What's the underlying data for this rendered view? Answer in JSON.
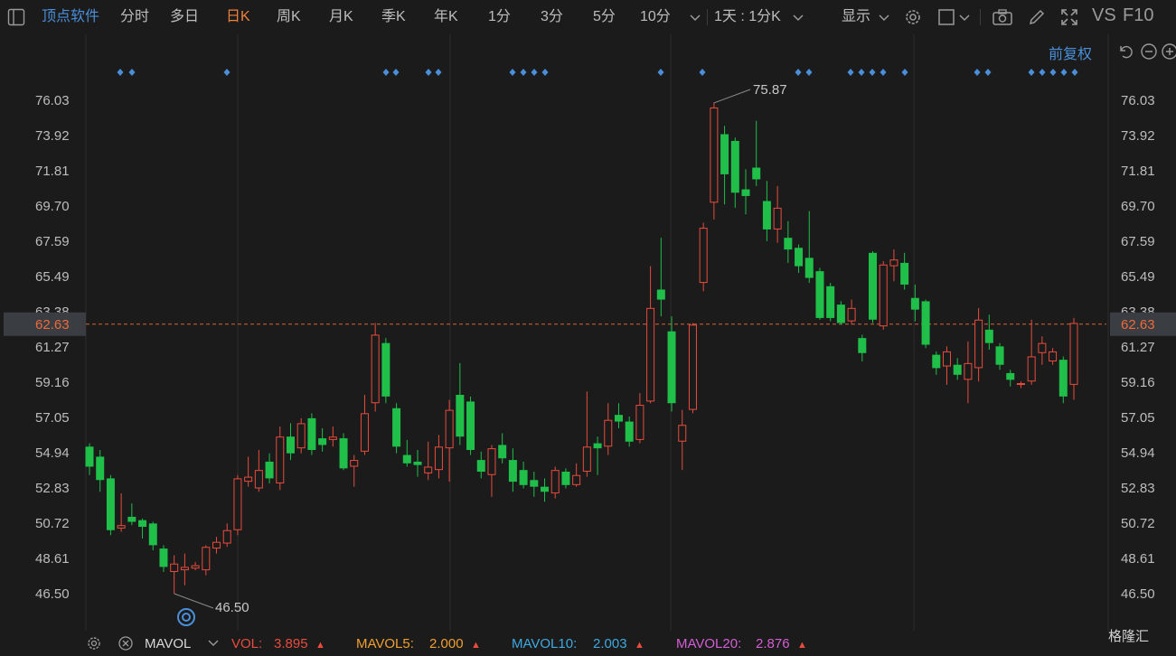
{
  "toolbar": {
    "app_name": "顶点软件",
    "periods": [
      "分时",
      "多日",
      "日K",
      "周K",
      "月K",
      "季K",
      "年K",
      "1分",
      "3分",
      "5分",
      "10分"
    ],
    "active_period": "日K",
    "interval_label": "1天 : 1分K",
    "display_label": "显示",
    "vs_label": "VS",
    "f10_label": "F10"
  },
  "chart_header": {
    "fq_label": "前复权"
  },
  "price_axis": {
    "labels": [
      "76.03",
      "73.92",
      "71.81",
      "69.70",
      "67.59",
      "65.49",
      "63.38",
      "61.27",
      "59.16",
      "57.05",
      "54.94",
      "52.83",
      "50.72",
      "48.61",
      "46.50"
    ],
    "current_price_label": "62.63"
  },
  "annotations": {
    "high_label": "75.87",
    "low_label": "46.50"
  },
  "indicator_bar": {
    "name": "MAVOL",
    "items": [
      {
        "label": "VOL:",
        "value": "3.895",
        "color": "#e84c3d"
      },
      {
        "label": "MAVOL5:",
        "value": "2.000",
        "color": "#f0a030"
      },
      {
        "label": "MAVOL10:",
        "value": "2.003",
        "color": "#3fa9e0"
      },
      {
        "label": "MAVOL20:",
        "value": "2.876",
        "color": "#d45ed4"
      }
    ]
  },
  "watermark": "格隆汇",
  "colors": {
    "up": "#e84c3d",
    "down": "#1fbf4a",
    "accent": "#4a8fd9",
    "active": "#f0813a",
    "grid": "#2c2c2e"
  },
  "chart_data": {
    "type": "candlestick",
    "ylim": [
      45.5,
      77.5
    ],
    "current_price": 62.63,
    "candles": [
      {
        "o": 55.3,
        "c": 54.1,
        "h": 55.5,
        "l": 53.6
      },
      {
        "o": 54.7,
        "c": 53.3,
        "h": 55.1,
        "l": 52.6
      },
      {
        "o": 53.4,
        "c": 50.3,
        "h": 53.6,
        "l": 50.0
      },
      {
        "o": 50.4,
        "c": 50.6,
        "h": 52.5,
        "l": 50.2
      },
      {
        "o": 51.1,
        "c": 50.8,
        "h": 51.9,
        "l": 50.6
      },
      {
        "o": 50.9,
        "c": 50.5,
        "h": 51.0,
        "l": 49.8
      },
      {
        "o": 50.7,
        "c": 49.4,
        "h": 50.8,
        "l": 49.1
      },
      {
        "o": 49.2,
        "c": 48.1,
        "h": 49.4,
        "l": 47.8
      },
      {
        "o": 47.8,
        "c": 48.3,
        "h": 48.8,
        "l": 46.5
      },
      {
        "o": 47.9,
        "c": 48.1,
        "h": 48.9,
        "l": 47.0
      },
      {
        "o": 48.0,
        "c": 48.2,
        "h": 48.4,
        "l": 47.9
      },
      {
        "o": 47.9,
        "c": 49.3,
        "h": 49.4,
        "l": 47.6
      },
      {
        "o": 49.2,
        "c": 49.6,
        "h": 49.9,
        "l": 48.9
      },
      {
        "o": 49.5,
        "c": 50.3,
        "h": 50.7,
        "l": 49.3
      },
      {
        "o": 50.3,
        "c": 53.4,
        "h": 53.6,
        "l": 50.0
      },
      {
        "o": 53.2,
        "c": 53.5,
        "h": 54.7,
        "l": 52.9
      },
      {
        "o": 52.8,
        "c": 53.9,
        "h": 55.1,
        "l": 52.6
      },
      {
        "o": 54.4,
        "c": 53.4,
        "h": 54.9,
        "l": 53.1
      },
      {
        "o": 53.1,
        "c": 55.9,
        "h": 56.5,
        "l": 52.7
      },
      {
        "o": 55.9,
        "c": 54.9,
        "h": 56.7,
        "l": 54.5
      },
      {
        "o": 55.2,
        "c": 56.7,
        "h": 57.0,
        "l": 54.9
      },
      {
        "o": 57.0,
        "c": 55.1,
        "h": 57.3,
        "l": 54.8
      },
      {
        "o": 55.8,
        "c": 55.4,
        "h": 56.4,
        "l": 55.0
      },
      {
        "o": 55.7,
        "c": 55.9,
        "h": 56.5,
        "l": 55.3
      },
      {
        "o": 55.8,
        "c": 54.0,
        "h": 56.1,
        "l": 53.9
      },
      {
        "o": 54.1,
        "c": 54.5,
        "h": 54.8,
        "l": 52.9
      },
      {
        "o": 55.0,
        "c": 57.3,
        "h": 58.4,
        "l": 54.8
      },
      {
        "o": 57.9,
        "c": 62.0,
        "h": 62.7,
        "l": 57.4
      },
      {
        "o": 61.5,
        "c": 58.3,
        "h": 61.8,
        "l": 57.9
      },
      {
        "o": 57.6,
        "c": 55.3,
        "h": 57.9,
        "l": 54.9
      },
      {
        "o": 54.8,
        "c": 54.3,
        "h": 55.7,
        "l": 54.1
      },
      {
        "o": 54.4,
        "c": 54.2,
        "h": 55.1,
        "l": 53.5
      },
      {
        "o": 53.7,
        "c": 54.1,
        "h": 55.6,
        "l": 53.3
      },
      {
        "o": 53.9,
        "c": 55.3,
        "h": 56.0,
        "l": 53.4
      },
      {
        "o": 55.2,
        "c": 57.5,
        "h": 58.1,
        "l": 53.2
      },
      {
        "o": 58.4,
        "c": 55.9,
        "h": 60.3,
        "l": 55.4
      },
      {
        "o": 58.0,
        "c": 55.1,
        "h": 58.3,
        "l": 54.8
      },
      {
        "o": 54.5,
        "c": 53.8,
        "h": 55.0,
        "l": 53.4
      },
      {
        "o": 53.6,
        "c": 55.2,
        "h": 55.4,
        "l": 52.3
      },
      {
        "o": 55.4,
        "c": 54.6,
        "h": 56.1,
        "l": 54.3
      },
      {
        "o": 54.5,
        "c": 53.2,
        "h": 55.2,
        "l": 52.6
      },
      {
        "o": 53.9,
        "c": 53.0,
        "h": 54.4,
        "l": 52.8
      },
      {
        "o": 53.3,
        "c": 52.9,
        "h": 53.8,
        "l": 52.3
      },
      {
        "o": 52.9,
        "c": 52.6,
        "h": 53.4,
        "l": 52.0
      },
      {
        "o": 52.5,
        "c": 53.9,
        "h": 54.1,
        "l": 52.2
      },
      {
        "o": 53.8,
        "c": 53.0,
        "h": 54.0,
        "l": 52.8
      },
      {
        "o": 53.0,
        "c": 53.6,
        "h": 54.3,
        "l": 52.9
      },
      {
        "o": 53.8,
        "c": 55.3,
        "h": 58.6,
        "l": 53.5
      },
      {
        "o": 55.5,
        "c": 55.2,
        "h": 55.9,
        "l": 53.6
      },
      {
        "o": 55.3,
        "c": 56.9,
        "h": 57.9,
        "l": 54.8
      },
      {
        "o": 57.2,
        "c": 56.8,
        "h": 57.9,
        "l": 56.4
      },
      {
        "o": 56.8,
        "c": 55.6,
        "h": 57.1,
        "l": 55.3
      },
      {
        "o": 55.7,
        "c": 57.8,
        "h": 58.5,
        "l": 55.5
      },
      {
        "o": 58.0,
        "c": 63.6,
        "h": 66.1,
        "l": 57.9
      },
      {
        "o": 64.7,
        "c": 64.1,
        "h": 67.8,
        "l": 63.1
      },
      {
        "o": 62.2,
        "c": 57.9,
        "h": 63.1,
        "l": 57.4
      },
      {
        "o": 55.6,
        "c": 56.6,
        "h": 57.5,
        "l": 53.9
      },
      {
        "o": 57.5,
        "c": 62.6,
        "h": 62.7,
        "l": 57.3
      },
      {
        "o": 65.1,
        "c": 68.4,
        "h": 68.7,
        "l": 64.6
      },
      {
        "o": 69.9,
        "c": 75.6,
        "h": 75.9,
        "l": 68.9
      },
      {
        "o": 74.0,
        "c": 71.6,
        "h": 74.5,
        "l": 69.8
      },
      {
        "o": 73.6,
        "c": 70.5,
        "h": 73.8,
        "l": 69.6
      },
      {
        "o": 70.7,
        "c": 70.3,
        "h": 71.9,
        "l": 69.2
      },
      {
        "o": 72.0,
        "c": 71.3,
        "h": 74.8,
        "l": 70.9
      },
      {
        "o": 70.0,
        "c": 68.3,
        "h": 71.2,
        "l": 67.6
      },
      {
        "o": 68.3,
        "c": 69.6,
        "h": 70.9,
        "l": 67.5
      },
      {
        "o": 67.8,
        "c": 67.1,
        "h": 68.8,
        "l": 66.3
      },
      {
        "o": 67.2,
        "c": 66.1,
        "h": 67.4,
        "l": 65.7
      },
      {
        "o": 66.6,
        "c": 65.4,
        "h": 69.4,
        "l": 65.1
      },
      {
        "o": 65.8,
        "c": 63.0,
        "h": 66.0,
        "l": 62.9
      },
      {
        "o": 64.9,
        "c": 63.0,
        "h": 65.1,
        "l": 62.8
      },
      {
        "o": 63.8,
        "c": 62.7,
        "h": 64.0,
        "l": 62.6
      },
      {
        "o": 62.8,
        "c": 63.6,
        "h": 64.1,
        "l": 62.6
      },
      {
        "o": 61.8,
        "c": 60.9,
        "h": 62.0,
        "l": 60.4
      },
      {
        "o": 66.9,
        "c": 62.9,
        "h": 67.0,
        "l": 62.7
      },
      {
        "o": 62.5,
        "c": 66.2,
        "h": 66.4,
        "l": 62.3
      },
      {
        "o": 66.1,
        "c": 66.5,
        "h": 67.1,
        "l": 65.2
      },
      {
        "o": 66.3,
        "c": 65.0,
        "h": 66.9,
        "l": 64.7
      },
      {
        "o": 64.2,
        "c": 63.5,
        "h": 65.0,
        "l": 62.8
      },
      {
        "o": 64.0,
        "c": 61.4,
        "h": 64.1,
        "l": 61.2
      },
      {
        "o": 60.8,
        "c": 60.0,
        "h": 61.0,
        "l": 59.6
      },
      {
        "o": 60.1,
        "c": 61.0,
        "h": 61.3,
        "l": 59.0
      },
      {
        "o": 60.2,
        "c": 59.6,
        "h": 60.6,
        "l": 59.3
      },
      {
        "o": 59.3,
        "c": 60.3,
        "h": 61.6,
        "l": 57.9
      },
      {
        "o": 60.0,
        "c": 62.9,
        "h": 63.6,
        "l": 59.2
      },
      {
        "o": 62.3,
        "c": 61.5,
        "h": 63.2,
        "l": 61.1
      },
      {
        "o": 61.3,
        "c": 60.2,
        "h": 61.5,
        "l": 59.9
      },
      {
        "o": 59.7,
        "c": 59.3,
        "h": 59.9,
        "l": 58.9
      },
      {
        "o": 59.0,
        "c": 59.1,
        "h": 59.2,
        "l": 58.8
      },
      {
        "o": 59.2,
        "c": 60.7,
        "h": 62.9,
        "l": 59.0
      },
      {
        "o": 60.9,
        "c": 61.5,
        "h": 61.9,
        "l": 60.2
      },
      {
        "o": 60.4,
        "c": 61.0,
        "h": 61.2,
        "l": 60.2
      },
      {
        "o": 60.5,
        "c": 58.3,
        "h": 60.7,
        "l": 57.9
      },
      {
        "o": 59.0,
        "c": 62.7,
        "h": 63.0,
        "l": 58.1
      }
    ],
    "markers_x_groups": "events",
    "high": 75.87,
    "low": 46.5
  }
}
